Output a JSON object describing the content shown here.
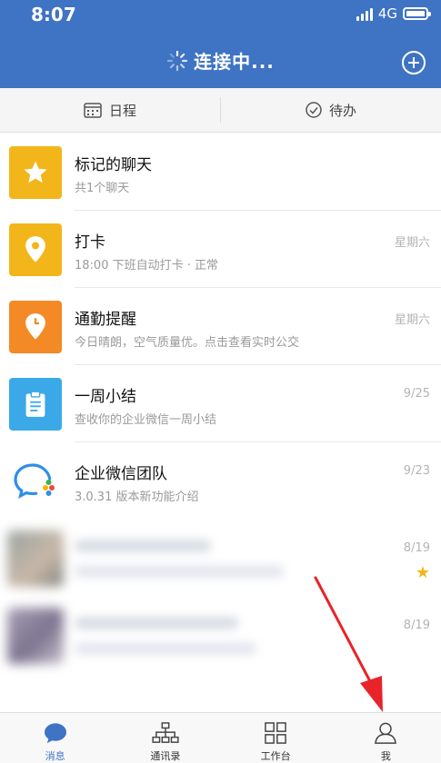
{
  "status_bar": {
    "time": "8:07",
    "network": "4G"
  },
  "header": {
    "title": "连接中..."
  },
  "tabs": [
    {
      "label": "日程"
    },
    {
      "label": "待办"
    }
  ],
  "chats": [
    {
      "name": "标记的聊天",
      "desc": "共1个聊天",
      "time": "",
      "icon": "star-icon",
      "color": "#f3b61a"
    },
    {
      "name": "打卡",
      "desc": "18:00 下班自动打卡 · 正常",
      "time": "星期六",
      "icon": "location-pin-icon",
      "color": "#f3b61a"
    },
    {
      "name": "通勤提醒",
      "desc": "今日晴朗，空气质量优。点击查看实时公交",
      "time": "星期六",
      "icon": "clock-pin-icon",
      "color": "#f38a25"
    },
    {
      "name": "一周小结",
      "desc": "查收你的企业微信一周小结",
      "time": "9/25",
      "icon": "clipboard-icon",
      "color": "#3ba9e8"
    },
    {
      "name": "企业微信团队",
      "desc": "3.0.31 版本新功能介绍",
      "time": "9/23",
      "icon": "wecom-logo-icon",
      "color": "#ffffff"
    }
  ],
  "blurred_chats": [
    {
      "time": "8/19"
    },
    {
      "time": "8/19"
    }
  ],
  "bottom_nav": [
    {
      "label": "消息",
      "icon": "chat-bubble-icon"
    },
    {
      "label": "通讯录",
      "icon": "org-chart-icon"
    },
    {
      "label": "工作台",
      "icon": "grid-icon"
    },
    {
      "label": "我",
      "icon": "person-icon"
    }
  ],
  "colors": {
    "header_blue": "#3f73c3",
    "active_tab": "#3f73c3",
    "annotation_arrow": "#e8232a"
  }
}
